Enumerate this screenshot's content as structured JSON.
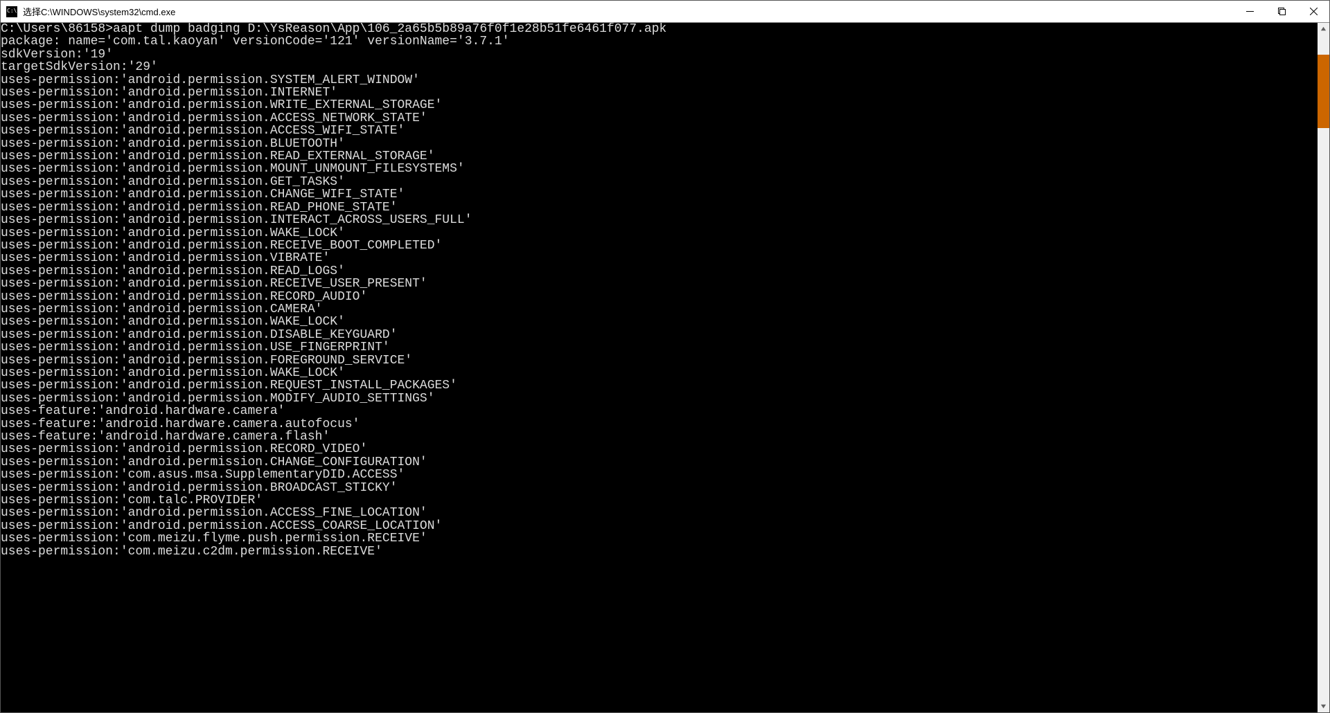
{
  "window": {
    "title": "选择C:\\WINDOWS\\system32\\cmd.exe"
  },
  "prompt": "C:\\Users\\86158>",
  "command": "aapt dump badging D:\\YsReason\\App\\106_2a65b5b89a76f0f1e28b51fe6461f077.apk",
  "package_line": "package: name='com.tal.kaoyan' versionCode='121' versionName='3.7.1'",
  "sdk_line": "sdkVersion:'19'",
  "target_sdk_line": "targetSdkVersion:'29'",
  "lines": [
    "uses-permission:'android.permission.SYSTEM_ALERT_WINDOW'",
    "uses-permission:'android.permission.INTERNET'",
    "uses-permission:'android.permission.WRITE_EXTERNAL_STORAGE'",
    "uses-permission:'android.permission.ACCESS_NETWORK_STATE'",
    "uses-permission:'android.permission.ACCESS_WIFI_STATE'",
    "uses-permission:'android.permission.BLUETOOTH'",
    "uses-permission:'android.permission.READ_EXTERNAL_STORAGE'",
    "uses-permission:'android.permission.MOUNT_UNMOUNT_FILESYSTEMS'",
    "uses-permission:'android.permission.GET_TASKS'",
    "uses-permission:'android.permission.CHANGE_WIFI_STATE'",
    "uses-permission:'android.permission.READ_PHONE_STATE'",
    "uses-permission:'android.permission.INTERACT_ACROSS_USERS_FULL'",
    "uses-permission:'android.permission.WAKE_LOCK'",
    "uses-permission:'android.permission.RECEIVE_BOOT_COMPLETED'",
    "uses-permission:'android.permission.VIBRATE'",
    "uses-permission:'android.permission.READ_LOGS'",
    "uses-permission:'android.permission.RECEIVE_USER_PRESENT'",
    "uses-permission:'android.permission.RECORD_AUDIO'",
    "uses-permission:'android.permission.CAMERA'",
    "uses-permission:'android.permission.WAKE_LOCK'",
    "uses-permission:'android.permission.DISABLE_KEYGUARD'",
    "uses-permission:'android.permission.USE_FINGERPRINT'",
    "uses-permission:'android.permission.FOREGROUND_SERVICE'",
    "uses-permission:'android.permission.WAKE_LOCK'",
    "uses-permission:'android.permission.REQUEST_INSTALL_PACKAGES'",
    "uses-permission:'android.permission.MODIFY_AUDIO_SETTINGS'",
    "uses-feature:'android.hardware.camera'",
    "uses-feature:'android.hardware.camera.autofocus'",
    "uses-feature:'android.hardware.camera.flash'",
    "uses-permission:'android.permission.RECORD_VIDEO'",
    "uses-permission:'android.permission.CHANGE_CONFIGURATION'",
    "uses-permission:'com.asus.msa.SupplementaryDID.ACCESS'",
    "uses-permission:'android.permission.BROADCAST_STICKY'",
    "uses-permission:'com.talc.PROVIDER'",
    "uses-permission:'android.permission.ACCESS_FINE_LOCATION'",
    "uses-permission:'android.permission.ACCESS_COARSE_LOCATION'",
    "uses-permission:'com.meizu.flyme.push.permission.RECEIVE'",
    "uses-permission:'com.meizu.c2dm.permission.RECEIVE'"
  ],
  "scrollbar": {
    "thumb_top_pct": 3,
    "thumb_height_pct": 11
  }
}
